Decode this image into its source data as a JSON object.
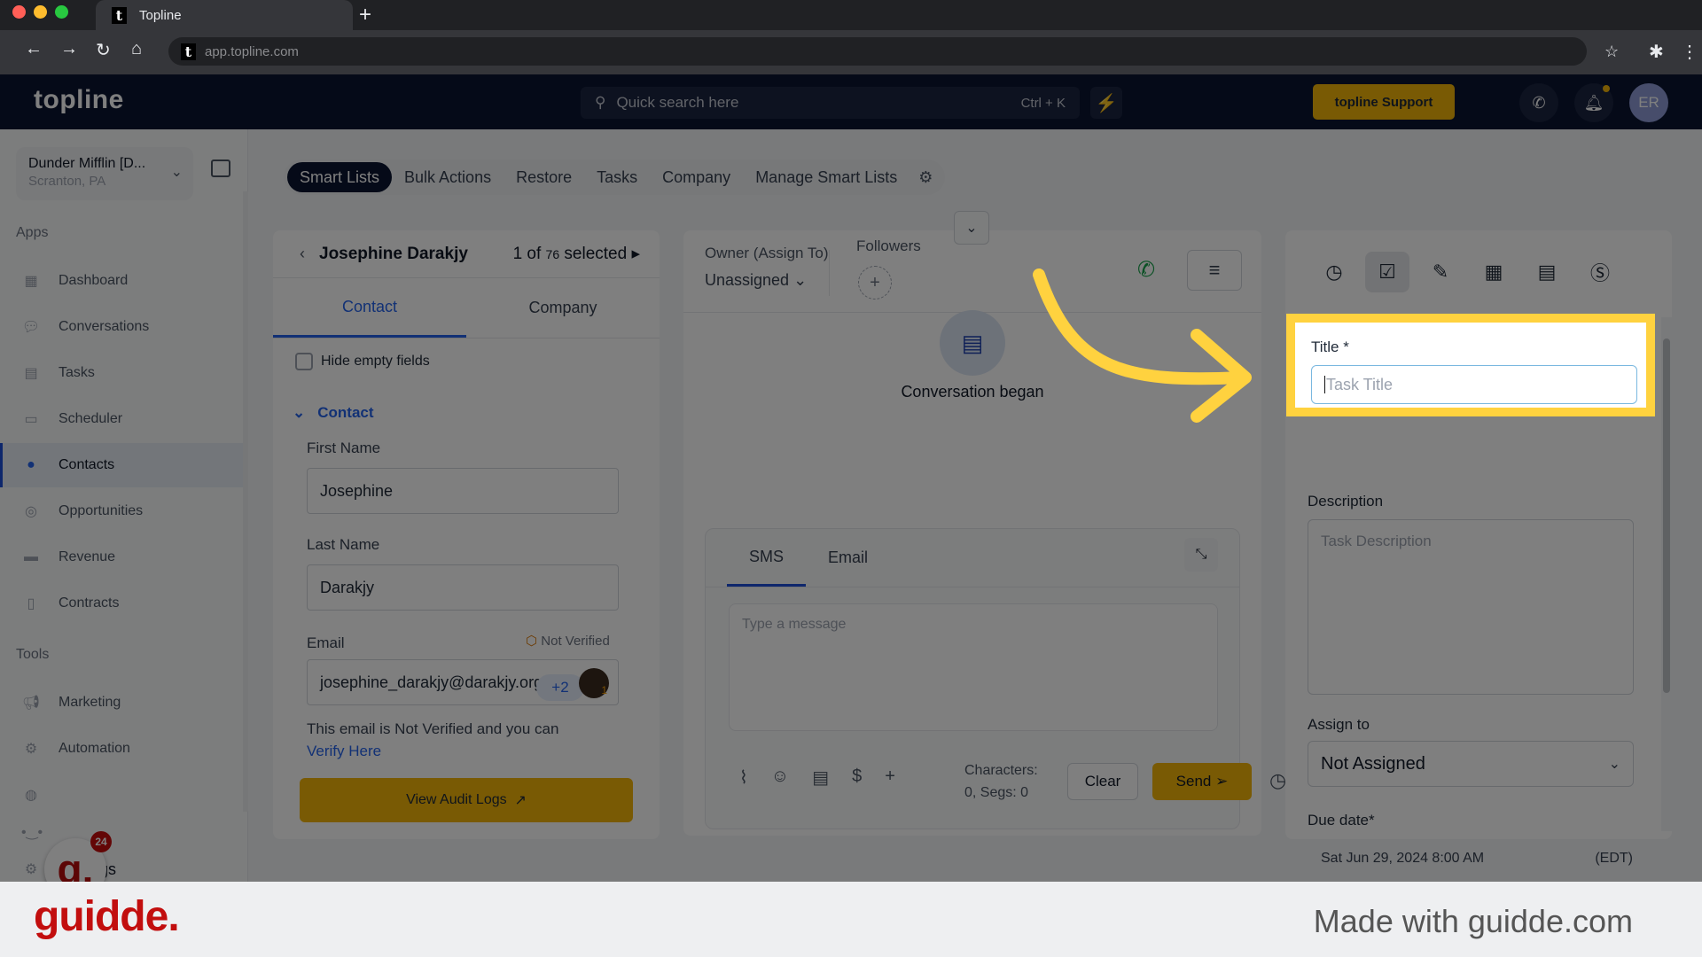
{
  "browser": {
    "tab_title": "Topline",
    "new_tab_icon": "plus-icon",
    "url": "app.topline.com"
  },
  "topbar": {
    "logo": "topline",
    "search_placeholder": "Quick search here",
    "search_shortcut": "Ctrl + K",
    "support_label": "topline Support",
    "avatar_initials": "ER",
    "accent_color": "#f2b408"
  },
  "sidebar": {
    "account_name": "Dunder Mifflin [D...",
    "account_location": "Scranton, PA",
    "apps_heading": "Apps",
    "tools_heading": "Tools",
    "apps": [
      {
        "label": "Dashboard",
        "icon": "dashboard-icon"
      },
      {
        "label": "Conversations",
        "icon": "conversations-icon"
      },
      {
        "label": "Tasks",
        "icon": "tasks-icon"
      },
      {
        "label": "Scheduler",
        "icon": "calendar-icon"
      },
      {
        "label": "Contacts",
        "icon": "user-icon",
        "active": true
      },
      {
        "label": "Opportunities",
        "icon": "target-icon"
      },
      {
        "label": "Revenue",
        "icon": "credit-card-icon"
      },
      {
        "label": "Contracts",
        "icon": "document-icon"
      }
    ],
    "tools": [
      {
        "label": "Marketing",
        "icon": "megaphone-icon"
      },
      {
        "label": "Automation",
        "icon": "gears-icon"
      },
      {
        "label": "",
        "icon": "globe-icon"
      },
      {
        "label": "",
        "icon": "dots-icon"
      }
    ],
    "settings_label": "Settings",
    "guidde_badge_count": "24"
  },
  "nav_tabs": [
    {
      "label": "Smart Lists",
      "active": true
    },
    {
      "label": "Bulk Actions"
    },
    {
      "label": "Restore"
    },
    {
      "label": "Tasks"
    },
    {
      "label": "Company"
    },
    {
      "label": "Manage Smart Lists"
    }
  ],
  "contact_panel": {
    "name": "Josephine Darakjy",
    "selection_prefix": "1 of ",
    "selection_total": "76",
    "selection_suffix": " selected",
    "tabs": [
      "Contact",
      "Company"
    ],
    "hide_empty_label": "Hide empty fields",
    "section_label": "Contact",
    "first_name_label": "First Name",
    "first_name_value": "Josephine",
    "last_name_label": "Last Name",
    "last_name_value": "Darakjy",
    "email_label": "Email",
    "email_status": "Not Verified",
    "email_value": "josephine_darakjy@darakjy.org",
    "email_extra_count": "+2",
    "avatar_badge": "1",
    "verify_text_1": "This email is Not Verified and you can ",
    "verify_link": "Verify Here",
    "audit_button": "View Audit Logs"
  },
  "conversation_panel": {
    "owner_label": "Owner (Assign To)",
    "owner_value": "Unassigned",
    "followers_label": "Followers",
    "conversation_status": "Conversation began",
    "composer_tabs": [
      "SMS",
      "Email"
    ],
    "message_placeholder": "Type a message",
    "characters_line1": "Characters:",
    "characters_line2": "0, Segs: 0",
    "clear_label": "Clear",
    "send_label": "Send"
  },
  "task_panel": {
    "toolbar_icons": [
      "history-icon",
      "task-check-icon",
      "pencil-icon",
      "calendar-icon",
      "document-icon",
      "dollar-icon"
    ],
    "title_label": "Title *",
    "title_placeholder": "Task Title",
    "description_label": "Description",
    "description_placeholder": "Task Description",
    "assign_label": "Assign to",
    "assign_value": "Not Assigned",
    "due_label": "Due date*",
    "due_value": "Sat Jun 29, 2024 8:00 AM",
    "due_tz": "(EDT)"
  },
  "footer": {
    "brand": "guidde.",
    "made_with": "Made with guidde.com"
  }
}
